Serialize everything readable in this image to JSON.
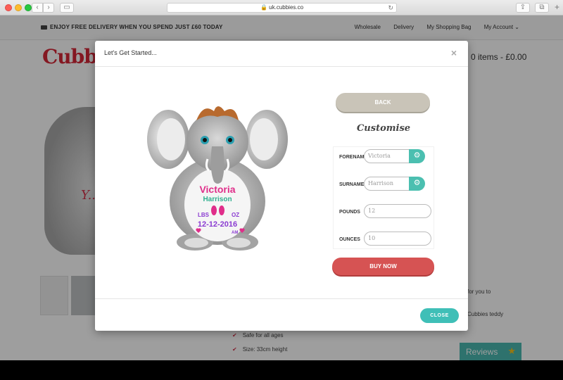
{
  "browser": {
    "url": "uk.cubbies.co"
  },
  "topbar": {
    "delivery": "ENJOY FREE DELIVERY WHEN YOU SPEND JUST £60 TODAY",
    "links": [
      "Wholesale",
      "Delivery",
      "My Shopping Bag",
      "My Account ⌄"
    ]
  },
  "header": {
    "logo": "Cubbi",
    "cart": "0 items - £0.00"
  },
  "background": {
    "bear_text": "Y... De...",
    "list": [
      "Safe for all ages",
      "Size: 33cm height"
    ],
    "side_text_1": "for you to",
    "side_text_2": "Cubbies teddy",
    "reviews": "Reviews"
  },
  "modal": {
    "title": "Let's Get Started...",
    "close_x": "×",
    "back_label": "BACK",
    "customise_title": "Customise",
    "fields": {
      "forename": {
        "label": "FORENAME",
        "placeholder": "Victoria"
      },
      "surname": {
        "label": "SURNAME",
        "placeholder": "Harrison"
      },
      "pounds": {
        "label": "POUNDS",
        "placeholder": "12"
      },
      "ounces": {
        "label": "OUNCES",
        "placeholder": "10"
      }
    },
    "buy_label": "BUY NOW",
    "close_label": "CLOSE"
  },
  "product_print": {
    "name": "Victoria",
    "surname": "Harrison",
    "lbs_label": "LBS",
    "oz_label": "OZ",
    "date": "12-12-2016",
    "time": "AM"
  },
  "colors": {
    "back_button": "#c9c4b8",
    "buy_button": "#d65353",
    "close_button": "#3fbfb7",
    "gear_button": "#4bbfb0",
    "brand": "#d62838"
  }
}
